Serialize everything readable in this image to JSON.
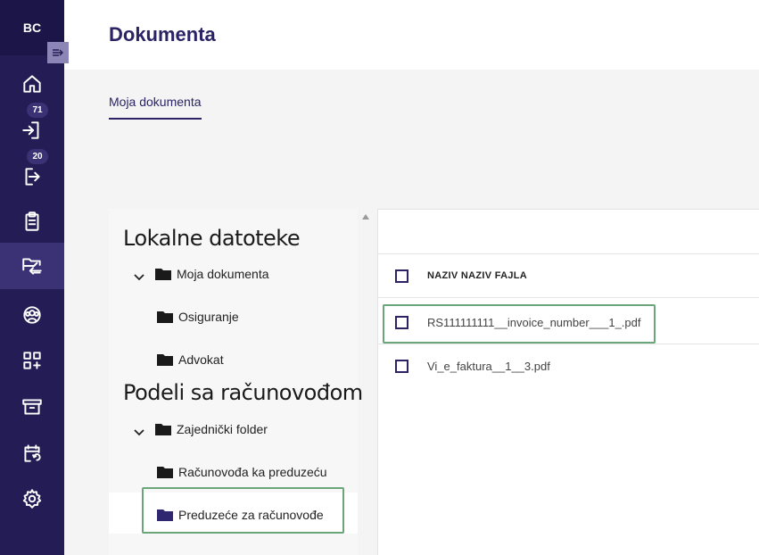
{
  "sidebar": {
    "brand": "BC",
    "badges": {
      "inbound": "71",
      "outbound": "20"
    },
    "items": [
      {
        "icon": "home-icon"
      },
      {
        "icon": "inbox-import-icon"
      },
      {
        "icon": "outbox-export-icon"
      },
      {
        "icon": "clipboard-icon"
      },
      {
        "icon": "folder-transfer-icon",
        "active": true
      },
      {
        "icon": "users-icon"
      },
      {
        "icon": "apps-add-icon"
      },
      {
        "icon": "archive-icon"
      },
      {
        "icon": "calendar-sync-icon"
      },
      {
        "icon": "settings-icon"
      }
    ],
    "colors": {
      "bg": "#241c55",
      "active": "#3b3275"
    }
  },
  "header": {
    "title": "Dokumenta"
  },
  "tabs": [
    {
      "label": "Moja dokumenta",
      "active": true
    }
  ],
  "tree": {
    "sections": [
      {
        "title": "Lokalne datoteke",
        "root": {
          "label": "Moja dokumenta",
          "expanded": true
        },
        "children": [
          {
            "label": "Osiguranje"
          },
          {
            "label": "Advokat"
          }
        ]
      },
      {
        "title": "Podeli sa računovođom",
        "root": {
          "label": "Zajednički folder",
          "expanded": true
        },
        "children": [
          {
            "label": "Računovođa ka preduzeću"
          },
          {
            "label": "Preduzeće za računovođe",
            "selected": true
          }
        ]
      }
    ]
  },
  "table": {
    "column_header": "NAZIV NAZIV FAJLA",
    "rows": [
      {
        "name": "RS111111111__invoice_number___1_.pdf",
        "highlighted": true
      },
      {
        "name": "Vi_e_faktura__1__3.pdf"
      }
    ]
  }
}
